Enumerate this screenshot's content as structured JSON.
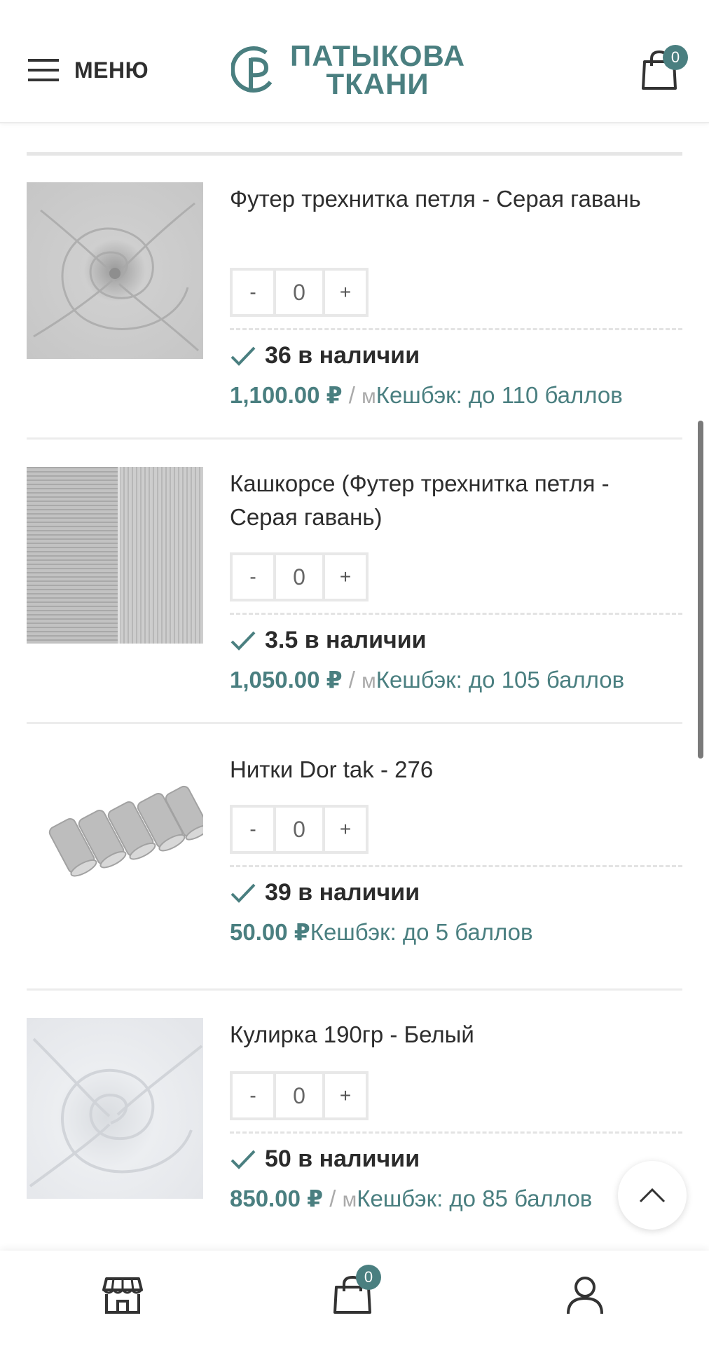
{
  "header": {
    "menu_label": "МЕНЮ",
    "logo_line1": "ПАТЫКОВА",
    "logo_line2": "ТКАНИ",
    "cart_count": "0"
  },
  "products": [
    {
      "title": "Футер трехнитка петля - Серая гавань",
      "qty_minus": "-",
      "qty_value": "0",
      "qty_plus": "+",
      "stock": "36 в наличии",
      "price": "1,100.00 ₽",
      "separator": " / ",
      "unit": "м",
      "cashback": "Кешбэк: до 110 баллов",
      "image": "grey-fabric-swirl"
    },
    {
      "title": "Кашкорсе (Футер трехнитка петля - Серая гавань)",
      "qty_minus": "-",
      "qty_value": "0",
      "qty_plus": "+",
      "stock": "3.5 в наличии",
      "price": "1,050.00 ₽",
      "separator": " / ",
      "unit": "м",
      "cashback": "Кешбэк: до 105 баллов",
      "image": "grey-rib-fabric"
    },
    {
      "title": "Нитки Dor tak - 276",
      "qty_minus": "-",
      "qty_value": "0",
      "qty_plus": "+",
      "stock": "39 в наличии",
      "price": "50.00 ₽",
      "separator": "",
      "unit": "",
      "cashback": "Кешбэк: до 5 баллов",
      "image": "grey-thread-spools"
    },
    {
      "title": "Кулирка 190гр - Белый",
      "qty_minus": "-",
      "qty_value": "0",
      "qty_plus": "+",
      "stock": "50 в наличии",
      "price": "850.00 ₽",
      "separator": " / ",
      "unit": "м",
      "cashback": "Кешбэк: до 85 баллов",
      "image": "white-fabric-swirl"
    }
  ],
  "bottom_bar": {
    "cart_count": "0",
    "icons": [
      "shop-icon",
      "cart-icon",
      "account-icon"
    ]
  },
  "colors": {
    "accent": "#4a7f80",
    "text": "#2b2b2b",
    "muted": "#aaaaaa",
    "border": "#e8e8e8"
  }
}
